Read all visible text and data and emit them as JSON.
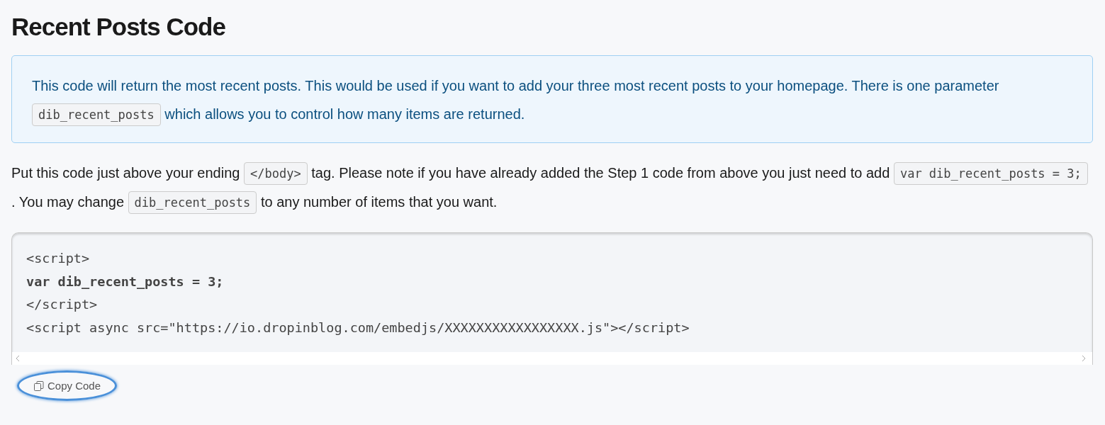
{
  "title": "Recent Posts Code",
  "info": [
    {
      "kind": "text",
      "text": "This code will return the most recent posts. This would be used if you want to add your three most recent posts to your homepage. There is one parameter"
    },
    {
      "kind": "code",
      "text": "dib_recent_posts"
    },
    {
      "kind": "text",
      "text": "which allows you to control how many items are returned."
    }
  ],
  "paragraph": [
    {
      "kind": "text",
      "text": "Put this code just above your ending"
    },
    {
      "kind": "code",
      "text": "</body>"
    },
    {
      "kind": "text",
      "text": "tag. Please note if you have already added the Step 1 code from above you just need to add"
    },
    {
      "kind": "code",
      "text": "var dib_recent_posts = 3;"
    },
    {
      "kind": "text",
      "text": ". You may change"
    },
    {
      "kind": "code",
      "text": "dib_recent_posts"
    },
    {
      "kind": "text",
      "text": "to any number of items that you want."
    }
  ],
  "code_lines": [
    {
      "kind": "plain",
      "text": "<script>"
    },
    {
      "kind": "bold",
      "text": "var dib_recent_posts = 3;"
    },
    {
      "kind": "plain",
      "text": "</script>"
    },
    {
      "kind": "plain",
      "text": "<script async src=\"https://io.dropinblog.com/embedjs/XXXXXXXXXXXXXXXXX.js\"></script>"
    }
  ],
  "copy_button": {
    "label": "Copy Code",
    "highlighted": true
  }
}
